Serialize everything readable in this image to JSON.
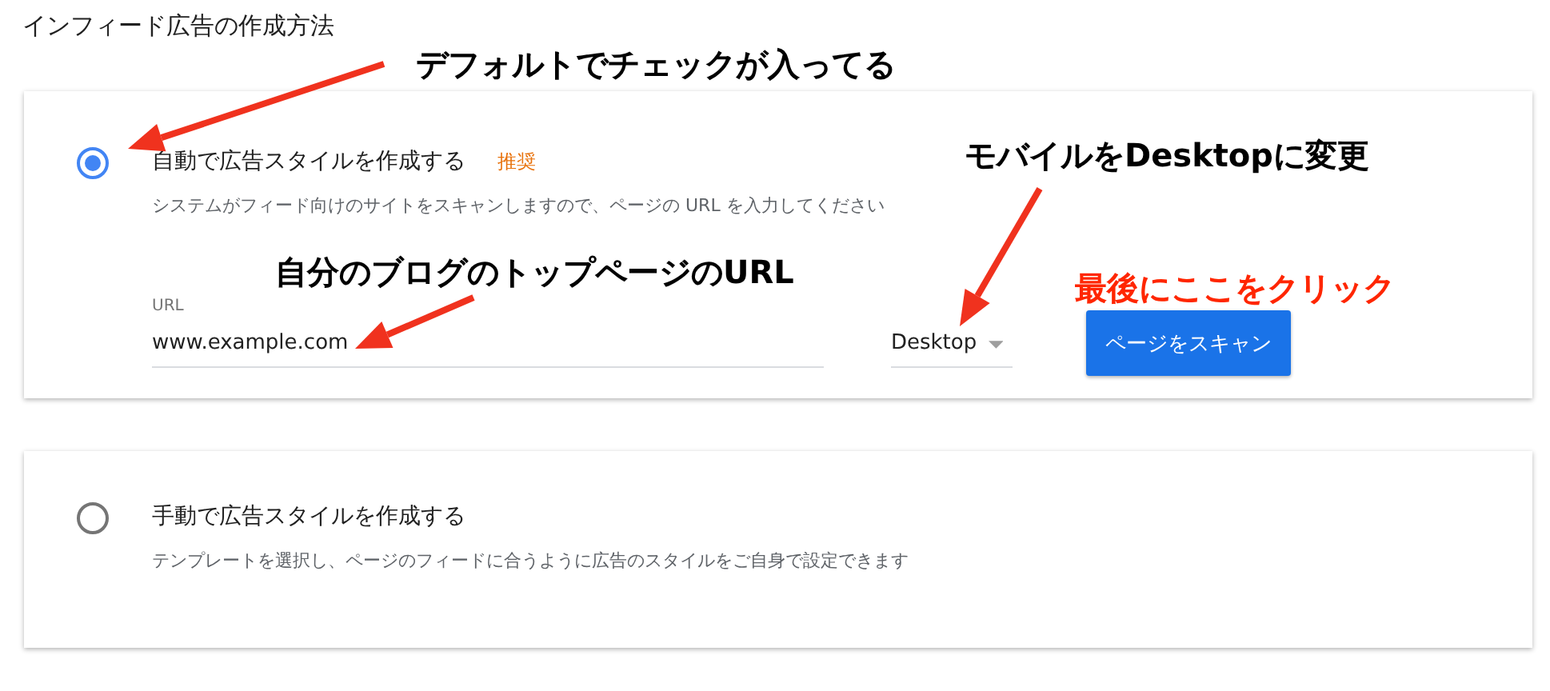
{
  "page_title": "インフィード広告の作成方法",
  "options": [
    {
      "label": "自動で広告スタイルを作成する",
      "badge": "推奨",
      "description": "システムがフィード向けのサイトをスキャンしますので、ページの URL を入力してください",
      "selected": true,
      "form": {
        "url_label": "URL",
        "url_value": "www.example.com",
        "device": "Desktop",
        "button": "ページをスキャン"
      }
    },
    {
      "label": "手動で広告スタイルを作成する",
      "description": "テンプレートを選択し、ページのフィードに合うように広告のスタイルをご自身で設定できます",
      "selected": false
    }
  ],
  "annotations": [
    {
      "text": "デフォルトでチェックが入ってる",
      "color": "#000000"
    },
    {
      "text": "モバイルをDesktopに変更",
      "color": "#000000"
    },
    {
      "text": "自分のブログのトップページのURL",
      "color": "#000000"
    },
    {
      "text": "最後にここをクリック",
      "color": "#ff2600"
    }
  ]
}
